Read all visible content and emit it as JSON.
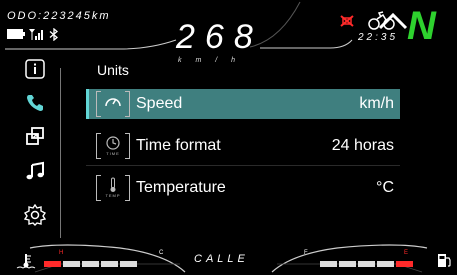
{
  "header": {
    "odometer": "ODO:223245km",
    "speed": "268",
    "speed_unit": "k m / h",
    "clock": "22:35",
    "gear": "N"
  },
  "page": {
    "title": "Units",
    "rows": [
      {
        "label": "Speed",
        "value": "km/h",
        "icon_caption": ""
      },
      {
        "label": "Time format",
        "value": "24 horas",
        "icon_caption": "TIME"
      },
      {
        "label": "Temperature",
        "value": "°C",
        "icon_caption": "TEMP"
      }
    ]
  },
  "footer": {
    "mode": "CALLE",
    "temp_gauge": {
      "low_label": "H",
      "high_label": "C"
    },
    "fuel_gauge": {
      "low_label": "F",
      "high_label": "E"
    }
  },
  "icons": {
    "nav": [
      "info-icon",
      "phone-icon",
      "swap-windows-icon",
      "music-icon",
      "settings-icon"
    ],
    "status": [
      "battery-icon",
      "signal-icon",
      "bluetooth-icon"
    ],
    "warnings": [
      "engine-warning-icon",
      "rider-icon",
      "road-warning-icon"
    ]
  },
  "colors": {
    "accent": "#62d6d6",
    "selected_row": "#3f7f7f",
    "gear": "#2ed12e",
    "warning": "#ff2a2a"
  }
}
